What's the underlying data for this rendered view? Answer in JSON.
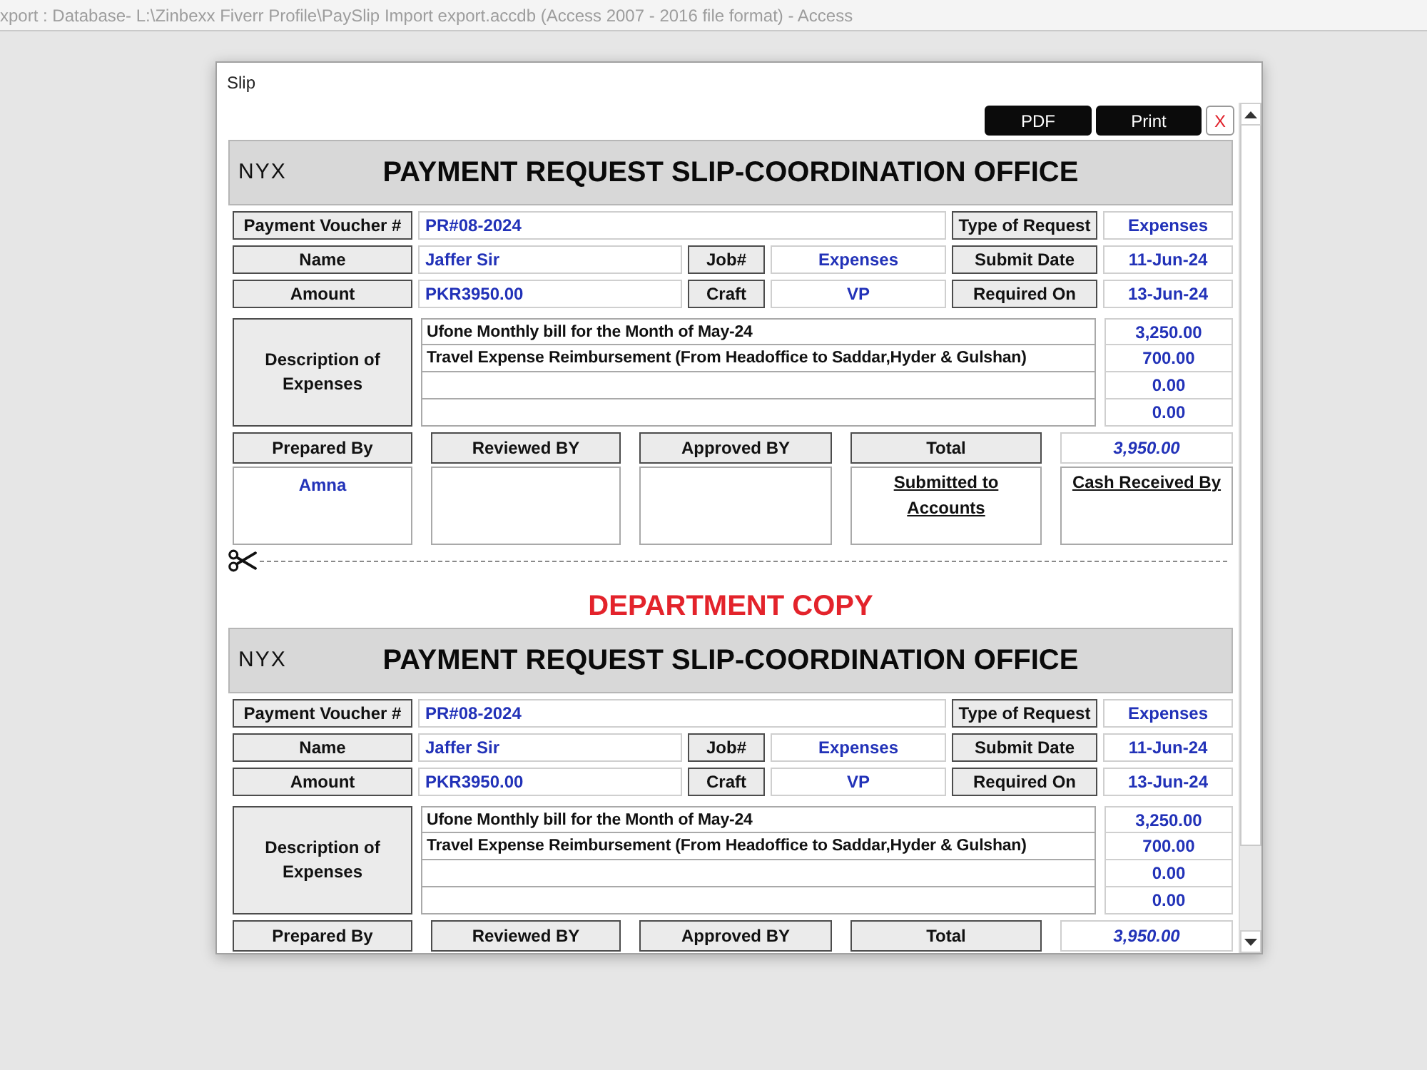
{
  "app_title": "xport : Database- L:\\Zinbexx Fiverr Profile\\PaySlip Import export.accdb (Access 2007 - 2016 file format) - Access",
  "dialog": {
    "title": "Slip",
    "buttons": [
      {
        "kind": "pdf",
        "label": "PDF"
      },
      {
        "kind": "print",
        "label": "Print"
      },
      {
        "kind": "close",
        "label": "X"
      }
    ]
  },
  "copies": [
    {
      "logo": "NYX",
      "title": "PAYMENT REQUEST SLIP-COORDINATION OFFICE",
      "rows": [
        [
          {
            "label": "Payment Voucher #",
            "value": "PR#08-2024"
          },
          "",
          {
            "label": "Type of Request",
            "value": "Expenses"
          }
        ],
        [
          {
            "label": "Name",
            "value": "Jaffer Sir"
          },
          {
            "label": "Job#",
            "value": "Expenses"
          },
          {
            "label": "Submit Date",
            "value": "11-Jun-24"
          }
        ],
        [
          {
            "label": "Amount",
            "value": "PKR3950.00"
          },
          {
            "label": "Craft",
            "value": "VP"
          },
          {
            "label": "Required On",
            "value": "13-Jun-24"
          }
        ]
      ],
      "description": {
        "label": "Description of Expenses",
        "lines": [
          {
            "text": "Ufone Monthly bill for the Month of May-24",
            "amount": "3,250.00"
          },
          {
            "text": "Travel Expense Reimbursement (From Headoffice to Saddar,Hyder & Gulshan)",
            "amount": "700.00"
          },
          {
            "amount": "0.00"
          },
          {
            "amount": "0.00"
          }
        ]
      },
      "signoff": {
        "headings": [
          "Prepared By",
          "Reviewed BY",
          "Approved BY",
          "Total"
        ],
        "total": "3,950.00",
        "boxes": [
          {
            "kind": "name",
            "text": "Amna"
          },
          {
            "kind": "blank"
          },
          {
            "kind": "blank"
          },
          {
            "kind": "caption",
            "text": "Submitted to Accounts"
          },
          {
            "kind": "caption",
            "text": "Cash Received By"
          }
        ]
      }
    },
    {
      "heading": "DEPARTMENT COPY",
      "logo": "NYX",
      "title": "PAYMENT REQUEST SLIP-COORDINATION OFFICE",
      "rows": [
        [
          {
            "label": "Payment Voucher #",
            "value": "PR#08-2024"
          },
          "",
          {
            "label": "Type of Request",
            "value": "Expenses"
          }
        ],
        [
          {
            "label": "Name",
            "value": "Jaffer Sir"
          },
          {
            "label": "Job#",
            "value": "Expenses"
          },
          {
            "label": "Submit Date",
            "value": "11-Jun-24"
          }
        ],
        [
          {
            "label": "Amount",
            "value": "PKR3950.00"
          },
          {
            "label": "Craft",
            "value": "VP"
          },
          {
            "label": "Required On",
            "value": "13-Jun-24"
          }
        ]
      ],
      "description": {
        "label": "Description of Expenses",
        "lines": [
          {
            "text": "Ufone Monthly bill for the Month of May-24",
            "amount": "3,250.00"
          },
          {
            "text": "Travel Expense Reimbursement (From Headoffice to Saddar,Hyder & Gulshan)",
            "amount": "700.00"
          },
          {
            "amount": "0.00"
          },
          {
            "amount": "0.00"
          }
        ]
      },
      "signoff": {
        "headings": [
          "Prepared By",
          "Reviewed BY",
          "Approved BY",
          "Total"
        ],
        "total": "3,950.00"
      }
    }
  ]
}
